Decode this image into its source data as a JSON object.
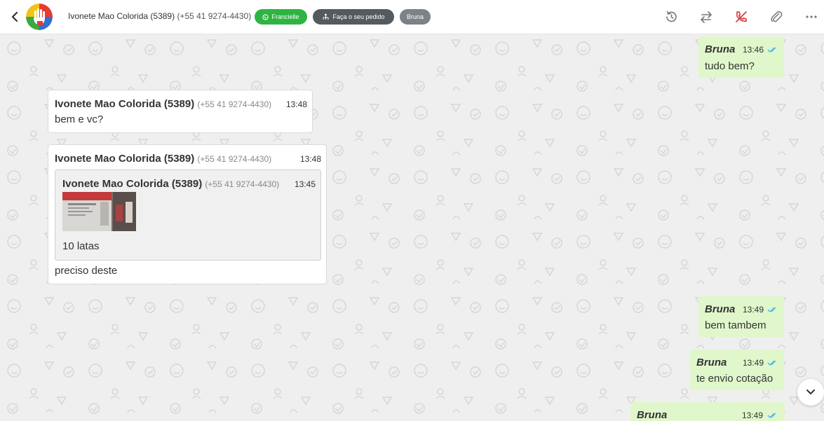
{
  "header": {
    "contact_name": "Ivonete Mao Colorida (5389)",
    "contact_phone": "(+55 41 9274-4430)",
    "tags": [
      {
        "label": "Francielle",
        "color": "#2fb443",
        "icon": "whatsapp-icon"
      },
      {
        "label": "Faça o seu pedido",
        "color": "#555a5e",
        "icon": "flow-icon"
      },
      {
        "label": "Bruna",
        "color": "#7b8288"
      }
    ],
    "toolbar_icons": [
      "history-icon",
      "transfer-icon",
      "end-call-icon",
      "paperclip-icon",
      "more-icon"
    ]
  },
  "messages": [
    {
      "direction": "out",
      "sender": "Bruna",
      "time": "13:46",
      "text": "tudo bem?",
      "status": "read"
    },
    {
      "direction": "in",
      "sender": "Ivonete Mao Colorida (5389)",
      "phone": "(+55 41 9274-4430)",
      "time": "13:48",
      "text": "bem e vc?"
    },
    {
      "direction": "in",
      "sender": "Ivonete Mao Colorida (5389)",
      "phone": "(+55 41 9274-4430)",
      "time": "13:48",
      "text": "preciso deste",
      "quoted": {
        "sender": "Ivonete Mao Colorida (5389)",
        "phone": "(+55 41 9274-4430)",
        "time": "13:45",
        "text": "10 latas",
        "has_image": true
      }
    },
    {
      "direction": "out",
      "sender": "Bruna",
      "time": "13:49",
      "text": "bem tambem",
      "status": "read"
    },
    {
      "direction": "out",
      "sender": "Bruna",
      "time": "13:49",
      "text": "te envio cotação",
      "status": "read"
    },
    {
      "direction": "out",
      "sender": "Bruna",
      "time": "13:49",
      "text": "",
      "status": "read"
    }
  ],
  "colors": {
    "outgoing_bubble": "#e0f7cb",
    "incoming_bubble": "#ffffff",
    "chat_background": "#efefef",
    "read_ticks": "#4fb6ec"
  }
}
